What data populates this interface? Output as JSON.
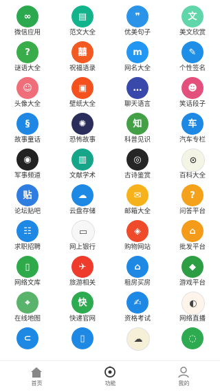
{
  "grid": {
    "items": [
      {
        "label": "微信应用",
        "icon": "wechat-app-icon",
        "glyph": "∞",
        "color": "#2ca94f"
      },
      {
        "label": "范文大全",
        "icon": "document-icon",
        "glyph": "▤",
        "color": "#13b48c"
      },
      {
        "label": "优美句子",
        "icon": "quote-icon",
        "glyph": "❞",
        "color": "#2b93e8"
      },
      {
        "label": "美文欣赏",
        "icon": "text-icon",
        "glyph": "文",
        "color": "#62d6ab"
      },
      {
        "label": "谜语大全",
        "icon": "lightbulb-icon",
        "glyph": "?",
        "color": "#39ad4a"
      },
      {
        "label": "祝福语录",
        "icon": "blessing-icon",
        "glyph": "囍",
        "color": "#f25a22"
      },
      {
        "label": "网名大全",
        "icon": "nickname-icon",
        "glyph": "m",
        "color": "#2196f3"
      },
      {
        "label": "个性签名",
        "icon": "signature-icon",
        "glyph": "✎",
        "color": "#1e8ee6"
      },
      {
        "label": "头像大全",
        "icon": "avatar-face-icon",
        "glyph": "☺",
        "color": "#f06e7a"
      },
      {
        "label": "壁纸大全",
        "icon": "wallpaper-icon",
        "glyph": "▣",
        "color": "#f4511e"
      },
      {
        "label": "聊天语言",
        "icon": "chat-icon",
        "glyph": "…",
        "color": "#3949ab"
      },
      {
        "label": "笑话段子",
        "icon": "joke-icon",
        "glyph": "☻",
        "color": "#e4507c"
      },
      {
        "label": "故事童话",
        "icon": "story-icon",
        "glyph": "§",
        "color": "#1f88e5"
      },
      {
        "label": "恐怖故事",
        "icon": "horror-icon",
        "glyph": "✺",
        "color": "#2b2e5a"
      },
      {
        "label": "科普见识",
        "icon": "science-icon",
        "glyph": "知",
        "color": "#43a047"
      },
      {
        "label": "汽车专栏",
        "icon": "car-icon",
        "glyph": "车",
        "color": "#1e88e5"
      },
      {
        "label": "军事频道",
        "icon": "military-icon",
        "glyph": "◉",
        "color": "#222222"
      },
      {
        "label": "文献学术",
        "icon": "book-icon",
        "glyph": "▥",
        "color": "#17a589"
      },
      {
        "label": "古诗鉴赏",
        "icon": "poem-icon",
        "glyph": "◎",
        "color": "#262626"
      },
      {
        "label": "百科大全",
        "icon": "encyclopedia-icon",
        "glyph": "⊙",
        "color": "#f5f5e6"
      },
      {
        "label": "论坛贴吧",
        "icon": "forum-icon",
        "glyph": "贴",
        "color": "#2f7de1"
      },
      {
        "label": "云盘存储",
        "icon": "cloud-drive-icon",
        "glyph": "☁",
        "color": "#1e88e5"
      },
      {
        "label": "邮箱大全",
        "icon": "mail-icon",
        "glyph": "✉",
        "color": "#f6b21b"
      },
      {
        "label": "问答平台",
        "icon": "question-icon",
        "glyph": "?",
        "color": "#f4a11b"
      },
      {
        "label": "求职招聘",
        "icon": "job-icon",
        "glyph": "☷",
        "color": "#1e88e5"
      },
      {
        "label": "网上银行",
        "icon": "bank-icon",
        "glyph": "▭",
        "color": "#f7f7f7"
      },
      {
        "label": "购物网站",
        "icon": "shopping-icon",
        "glyph": "◈",
        "color": "#ef4a2a"
      },
      {
        "label": "批发平台",
        "icon": "wholesale-icon",
        "glyph": "⌂",
        "color": "#f49b1a"
      },
      {
        "label": "网络文库",
        "icon": "library-icon",
        "glyph": "▯",
        "color": "#2faa4a"
      },
      {
        "label": "旅游相关",
        "icon": "travel-icon",
        "glyph": "✈",
        "color": "#ef3b2c"
      },
      {
        "label": "租房买房",
        "icon": "house-icon",
        "glyph": "⌂",
        "color": "#1e88e5"
      },
      {
        "label": "游戏平台",
        "icon": "game-icon",
        "glyph": "◆",
        "color": "#2e9e45"
      },
      {
        "label": "在线地图",
        "icon": "map-icon",
        "glyph": "⌖",
        "color": "#5ab36a"
      },
      {
        "label": "快递官网",
        "icon": "express-icon",
        "glyph": "快",
        "color": "#2eaa50"
      },
      {
        "label": "资格考试",
        "icon": "exam-icon",
        "glyph": "✍",
        "color": "#1e88e5"
      },
      {
        "label": "网络直播",
        "icon": "live-icon",
        "glyph": "◐",
        "color": "#fff4ea"
      },
      {
        "label": "",
        "icon": "partial-icon-blue",
        "glyph": "⊂",
        "color": "#1e88e5"
      },
      {
        "label": "",
        "icon": "phone-icon",
        "glyph": "▯",
        "color": "#1e88e5"
      },
      {
        "label": "",
        "icon": "weather-icon",
        "glyph": "☁",
        "color": "#f6f0d8"
      },
      {
        "label": "",
        "icon": "wechat-icon",
        "glyph": "◌",
        "color": "#2eaa50"
      }
    ]
  },
  "tabbar": {
    "tabs": [
      {
        "label": "首页",
        "icon": "home-icon"
      },
      {
        "label": "功能",
        "icon": "function-icon"
      },
      {
        "label": "我的",
        "icon": "profile-icon"
      }
    ]
  }
}
